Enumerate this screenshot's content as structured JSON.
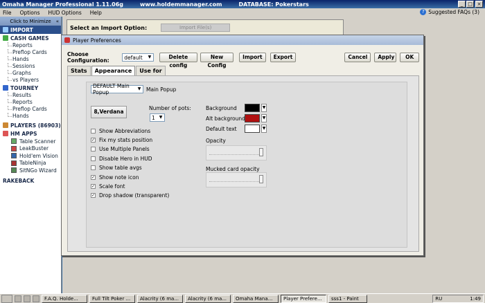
{
  "app": {
    "title": "Omaha Manager Professional 1.11.06g",
    "site": "www.holdemmanager.com",
    "database": "DATABASE: Pokerstars"
  },
  "menu": {
    "items": [
      "File",
      "Options",
      "HUD Options",
      "Help"
    ],
    "faq": "Suggested FAQs (3)"
  },
  "sidebar": {
    "minimize": "Click to Minimize",
    "import": "IMPORT",
    "cash_games": "CASH GAMES",
    "cash_items": [
      "Reports",
      "Preflop Cards",
      "Hands",
      "Sessions",
      "Graphs",
      "vs Players"
    ],
    "tourney": "TOURNEY",
    "tourney_items": [
      "Results",
      "Reports",
      "Preflop Cards",
      "Hands"
    ],
    "players": "PLAYERS (86903)",
    "hm_apps": "HM APPS",
    "apps": [
      "Table Scanner",
      "LeakBuster",
      "Hold'em Vision",
      "TableNinja",
      "SitNGo Wizard"
    ],
    "rakeback": "RAKEBACK"
  },
  "main": {
    "import_label": "Select an Import Option:",
    "import_ghost": "Import File(s)"
  },
  "dialog": {
    "title": "Player Preferences",
    "config_label": "Choose Configuration:",
    "config_value": "default",
    "buttons": {
      "delete": "Delete config",
      "new": "New Config",
      "import": "Import",
      "export": "Export",
      "cancel": "Cancel",
      "apply": "Apply",
      "ok": "OK"
    },
    "tabs": [
      "Stats",
      "Appearance",
      "Use for"
    ],
    "popup_select": "DEFAULT Main Popup",
    "popup_label": "Main Popup",
    "font_button": "8,Verdana",
    "num_pots_label": "Number of pots:",
    "num_pots_value": "1",
    "colors": {
      "background_label": "Background",
      "background": "#000000",
      "alt_label": "Alt background",
      "alt": "#b01010",
      "text_label": "Default text",
      "text": "#ffffff"
    },
    "opacity_label": "Opacity",
    "mucked_label": "Mucked card opacity",
    "options": [
      {
        "label": "Show Abbreviations",
        "checked": false
      },
      {
        "label": "Fix my stats position",
        "checked": true
      },
      {
        "label": "Use Multiple Panels",
        "checked": false
      },
      {
        "label": "Disable Hero in HUD",
        "checked": false
      },
      {
        "label": "Show table avgs",
        "checked": false
      },
      {
        "label": "Show note icon",
        "checked": true
      },
      {
        "label": "Scale font",
        "checked": true
      },
      {
        "label": "Drop shadow (transparent)",
        "checked": true
      }
    ]
  },
  "taskbar": {
    "tasks": [
      "F.A.Q. Holde...",
      "Full Tilt Poker ...",
      "Alacrity (6 ma...",
      "Alacrity (6 ma...",
      "Omaha Mana...",
      "Player Prefere...",
      "sss1 - Paint"
    ],
    "lang": "RU",
    "time": "1:49"
  }
}
